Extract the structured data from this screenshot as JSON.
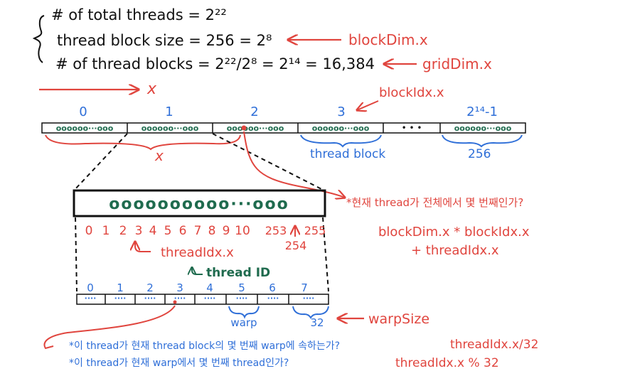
{
  "equations": {
    "total_threads": "# of total threads = 2²²",
    "block_size": "thread block size = 256 = 2⁸",
    "num_blocks": "# of thread blocks = 2²²/2⁸ = 2¹⁴ = 16,384"
  },
  "arrow_labels": {
    "block_dim": "blockDim.x",
    "grid_dim": "gridDim.x",
    "axis": "x",
    "block_idx": "blockIdx.x"
  },
  "grid": {
    "block_indices": [
      "0",
      "1",
      "2",
      "3",
      "2¹⁴-1"
    ],
    "cell_text": "oooooo···ooo",
    "ellipsis": "• • •",
    "x_label": "x",
    "thread_block_label": "thread block",
    "size_label": "256"
  },
  "question1": {
    "text": "*현재 thread가 전체에서 몇 번째인가?",
    "answer_line1": "blockDim.x * blockIdx.x",
    "answer_line2": "+ threadIdx.x"
  },
  "block_detail": {
    "circles_text": "oooooooooo···ooo",
    "indices": [
      "0",
      "1",
      "2",
      "3",
      "4",
      "5",
      "6",
      "7",
      "8",
      "9",
      "10"
    ],
    "idx_253": "253",
    "idx_255": "255",
    "idx_254": "254",
    "thread_idx_label": "threadIdx.x",
    "thread_id_label": "thread ID"
  },
  "warps": {
    "indices": [
      "0",
      "1",
      "2",
      "3",
      "4",
      "5",
      "6",
      "7"
    ],
    "cell_text": "····",
    "warp_label": "warp",
    "warp_count": "32",
    "warp_size_label": "warpSize"
  },
  "footer": {
    "q2_text": "*이 thread가 현재 thread block의 몇 번째 warp에 속하는가?",
    "q2_answer": "threadIdx.x/32",
    "q3_text": "*이 thread가 현재 warp에서 몇 번째 thread인가?",
    "q3_answer": "threadIdx.x % 32"
  },
  "colors": {
    "black": "#111111",
    "red": "#e0453e",
    "blue": "#2f6fd8",
    "green": "#1f6b4e"
  }
}
